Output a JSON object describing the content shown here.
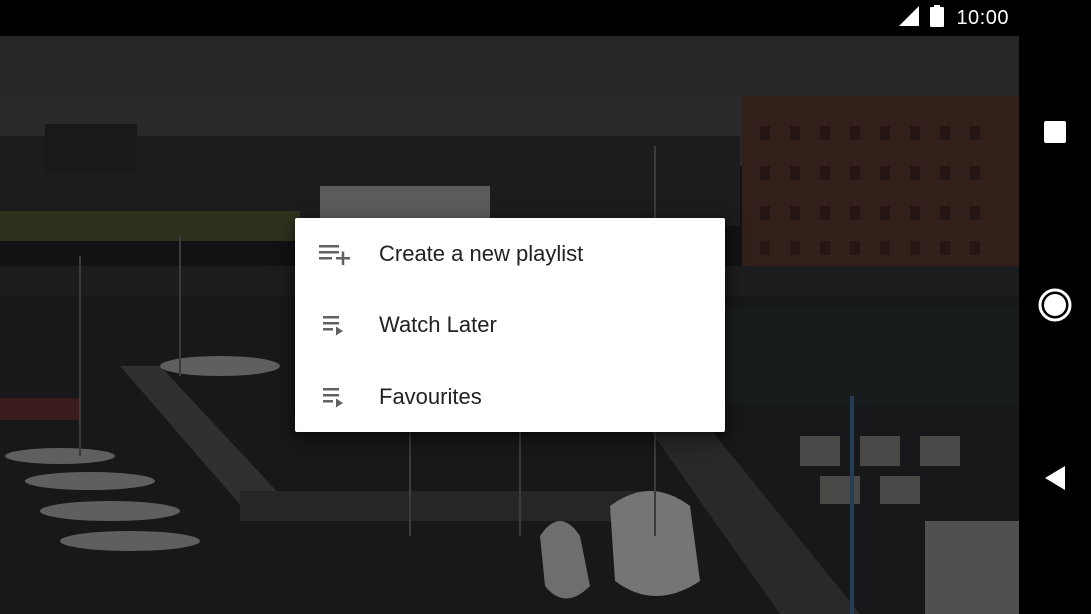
{
  "status_bar": {
    "time": "10:00",
    "icons": [
      "cellular-signal-icon",
      "battery-icon"
    ]
  },
  "video": {
    "description_icon": "harbor-video-frame"
  },
  "dialog": {
    "items": [
      {
        "label": "Create a new playlist",
        "icon": "playlist-add-icon"
      },
      {
        "label": "Watch Later",
        "icon": "playlist-play-icon"
      },
      {
        "label": "Favourites",
        "icon": "playlist-play-icon"
      }
    ]
  },
  "nav_bar": {
    "buttons": [
      "recents-square-icon",
      "home-circle-icon",
      "back-triangle-icon"
    ]
  },
  "colors": {
    "dialog_bg": "#ffffff",
    "text_primary": "#212121",
    "icon_gray": "#616161",
    "scrim": "#000000"
  }
}
